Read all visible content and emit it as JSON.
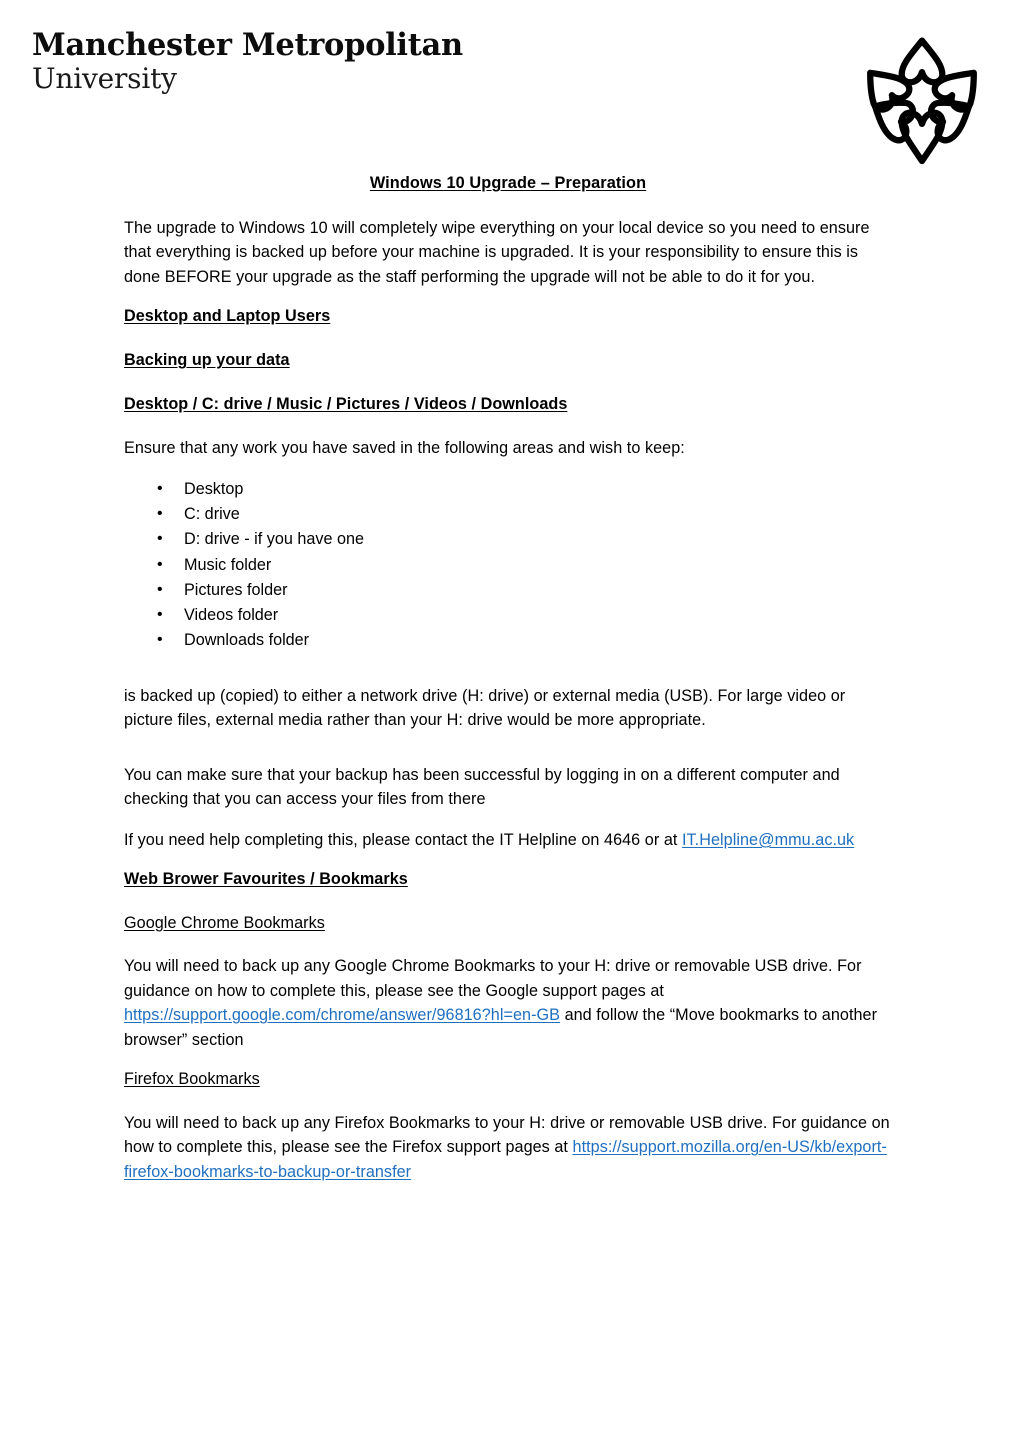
{
  "header": {
    "logo_line1": "Manchester Metropolitan",
    "logo_line2": "University",
    "logo_mark_name": "mmu-flower-logo"
  },
  "document": {
    "title": "Windows 10 Upgrade – Preparation",
    "intro_paragraph": "The upgrade to Windows 10 will completely wipe everything on your local device so you need to ensure that everything is backed up before your machine is upgraded. It is your responsibility to ensure this is done BEFORE your upgrade as the staff performing the upgrade will not be able to do it for you.",
    "heading_desktop_laptop": "Desktop and Laptop Users",
    "heading_backing_up": "Backing up your data",
    "heading_locations": "Desktop / C: drive / Music / Pictures / Videos / Downloads",
    "ensure_paragraph": "Ensure that any work you have saved in the following areas and wish to keep:",
    "backup_locations": [
      "Desktop",
      "C: drive",
      "D: drive - if you have one",
      "Music folder",
      "Pictures folder",
      "Videos folder",
      "Downloads folder"
    ],
    "bullet_glyph": "•",
    "backed_up_paragraph": "is backed up (copied) to either a network drive (H: drive) or external media (USB). For large video or picture files, external media rather than your H: drive would be more appropriate.",
    "verify_paragraph": "You can make sure that your backup has been successful by logging in on a different computer and checking that you can access your files from there",
    "helpline_text": "If you need help completing this, please contact the IT Helpline on 4646 or at ",
    "helpline_email": "IT.Helpline@mmu.ac.uk",
    "heading_bookmarks": "Web Brower Favourites / Bookmarks",
    "heading_chrome": "Google Chrome Bookmarks",
    "chrome_paragraph_before": "You will need to back up any Google Chrome Bookmarks to your H: drive or removable USB drive. For guidance on how to complete this, please see the Google support pages at ",
    "chrome_link": "https://support.google.com/chrome/answer/96816?hl=en-GB",
    "chrome_paragraph_after": " and follow the “Move bookmarks to another browser” section",
    "heading_firefox": "Firefox Bookmarks",
    "firefox_paragraph_before": "You will need to back up any Firefox Bookmarks to your H: drive or removable USB drive. For guidance on how to complete this, please see the Firefox support pages at ",
    "firefox_link": "https://support.mozilla.org/en-US/kb/export-firefox-bookmarks-to-backup-or-transfer"
  },
  "colors": {
    "link": "#1F6FC1",
    "text": "#000000",
    "background": "#FFFFFF"
  }
}
